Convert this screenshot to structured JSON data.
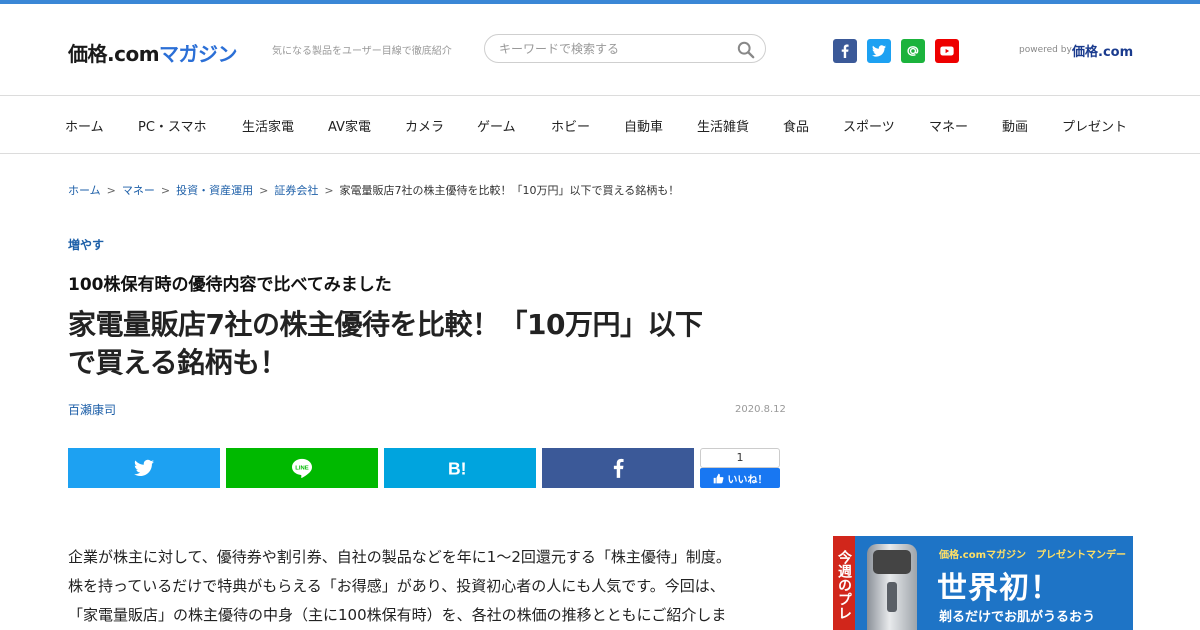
{
  "header": {
    "logo_main": "価格.com",
    "logo_sub": "マガジン",
    "tagline": "気になる製品をユーザー目線で徹底紹介",
    "search_placeholder": "キーワードで検索する",
    "powered_by": "powered by",
    "powered_logo": "価格.com",
    "social": [
      "facebook-icon",
      "twitter-icon",
      "mail-icon",
      "youtube-icon"
    ]
  },
  "nav": {
    "items": [
      "ホーム",
      "PC・スマホ",
      "生活家電",
      "AV家電",
      "カメラ",
      "ゲーム",
      "ホビー",
      "自動車",
      "生活雑貨",
      "食品",
      "スポーツ",
      "マネー",
      "動画",
      "プレゼント"
    ]
  },
  "breadcrumb": {
    "links": [
      "ホーム",
      "マネー",
      "投資・資産運用",
      "証券会社"
    ],
    "separator": ">",
    "current": "家電量販店7社の株主優待を比較！「10万円」以下で買える銘柄も！"
  },
  "article": {
    "category": "増やす",
    "subtitle": "100株保有時の優待内容で比べてみました",
    "title_line1": "家電量販店7社の株主優待を比較！「10万円」以下",
    "title_line2": "で買える銘柄も！",
    "author": "百瀬康司",
    "date": "2020.8.12",
    "body_lines": [
      "企業が株主に対して、優待券や割引券、自社の製品などを年に1～2回還元する「株主優待」制度。",
      "株を持っているだけで特典がもらえる「お得感」があり、投資初心者の人にも人気です。今回は、",
      "「家電量販店」の株主優待の中身（主に100株保有時）を、各社の株価の推移とともにご紹介しま"
    ]
  },
  "share": {
    "like_count": "1",
    "like_label": "いいね！",
    "colors": {
      "twitter": "#1da1f2",
      "line": "#00b900",
      "hatena": "#00a4de",
      "facebook": "#3b5998"
    }
  },
  "ad": {
    "side_text": "今週のプレ",
    "label": "価格.comマガジン　プレゼントマンデー",
    "headline": "世界初！",
    "sub": "剃るだけでお肌がうるおう"
  }
}
